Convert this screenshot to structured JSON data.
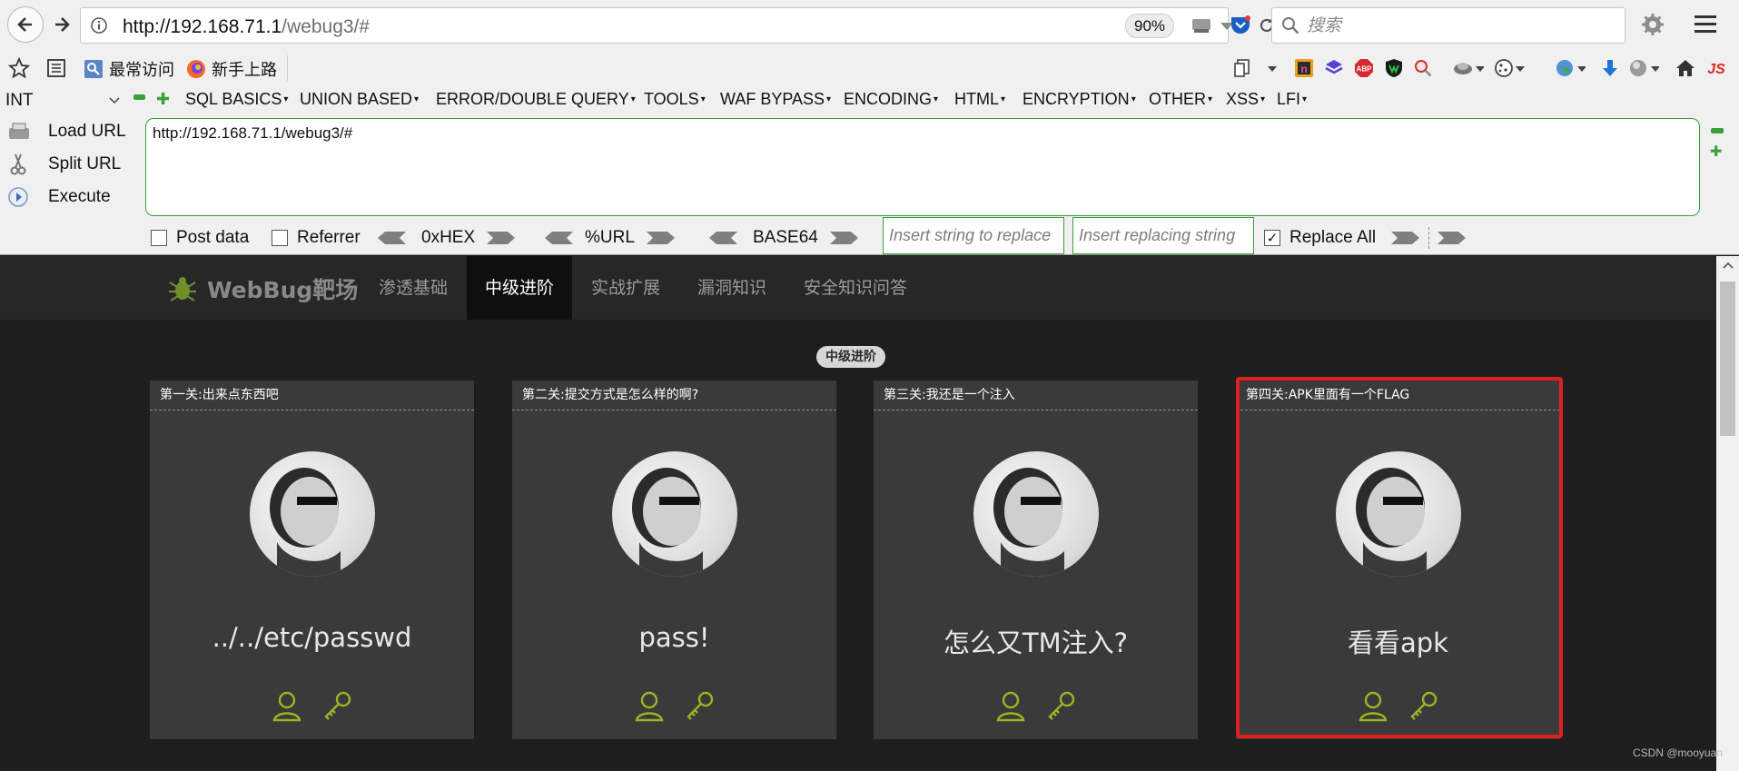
{
  "browser": {
    "url_host": "http://192.168.71.1",
    "url_path": "/webug3/#",
    "zoom": "90%",
    "search_placeholder": "搜索",
    "bookmarks": [
      "最常访问",
      "新手上路"
    ]
  },
  "hackbar": {
    "select_value": "INT",
    "menus": [
      "SQL BASICS",
      "UNION BASED",
      "ERROR/DOUBLE QUERY",
      "TOOLS",
      "WAF BYPASS",
      "ENCODING",
      "HTML",
      "ENCRYPTION",
      "OTHER",
      "XSS",
      "LFI"
    ],
    "actions": [
      "Load URL",
      "Split URL",
      "Execute"
    ],
    "url_value": "http://192.168.71.1/webug3/#",
    "options": {
      "post_data": "Post data",
      "referrer": "Referrer",
      "hex": "0xHEX",
      "url": "%URL",
      "base64": "BASE64",
      "replace_all": "Replace All"
    },
    "insert_placeholder": "Insert string to replace",
    "replacing_placeholder": "Insert replacing string"
  },
  "site": {
    "logo": "WebBug靶场",
    "nav": [
      "渗透基础",
      "中级进阶",
      "实战扩展",
      "漏洞知识",
      "安全知识问答"
    ],
    "active_nav": "中级进阶",
    "section_badge": "中级进阶",
    "cards": [
      {
        "title": "第一关:出来点东西吧",
        "main": "../../etc/passwd"
      },
      {
        "title": "第二关:提交方式是怎么样的啊?",
        "main": "pass!"
      },
      {
        "title": "第三关:我还是一个注入",
        "main": "怎么又TM注入?"
      },
      {
        "title": "第四关:APK里面有一个FLAG",
        "main": "看看apk"
      }
    ],
    "highlight_color": "#e01f1f",
    "accent_color": "#9ab422"
  },
  "watermark": "CSDN @mooyuan"
}
